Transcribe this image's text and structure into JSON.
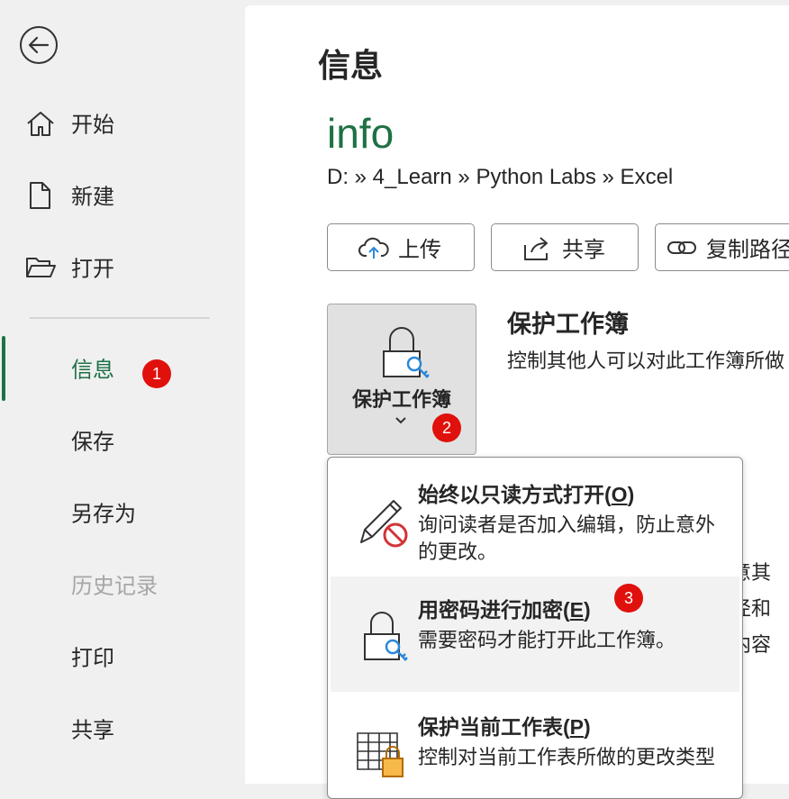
{
  "sidebar": {
    "back_icon": "arrow-left-circle-icon",
    "items": [
      {
        "label": "开始",
        "icon": "home-icon"
      },
      {
        "label": "新建",
        "icon": "new-document-icon"
      },
      {
        "label": "打开",
        "icon": "folder-open-icon"
      },
      {
        "label": "信息",
        "active": true
      },
      {
        "label": "保存"
      },
      {
        "label": "另存为"
      },
      {
        "label": "历史记录",
        "disabled": true
      },
      {
        "label": "打印"
      },
      {
        "label": "共享"
      }
    ]
  },
  "badges": [
    "1",
    "2",
    "3"
  ],
  "main": {
    "title": "信息",
    "file_name": "info",
    "file_path": "D: » 4_Learn » Python Labs » Excel",
    "buttons": {
      "upload": "上传",
      "share": "共享",
      "copy_path": "复制路径"
    },
    "protect": {
      "tile_label": "保护工作簿",
      "title": "保护工作簿",
      "description": "控制其他人可以对此工作簿所做",
      "bg_fragments": [
        "意其",
        "径和",
        "内容"
      ]
    }
  },
  "dropdown": {
    "items": [
      {
        "title": "始终以只读方式打开(",
        "key": "O",
        "suffix": ")",
        "desc": "询问读者是否加入编辑，防止意外的更改。",
        "icon": "pencil-no-icon"
      },
      {
        "title": "用密码进行加密(",
        "key": "E",
        "suffix": ")",
        "desc": "需要密码才能打开此工作簿。",
        "icon": "lock-key-icon"
      },
      {
        "title": "保护当前工作表(",
        "key": "P",
        "suffix": ")",
        "desc": "控制对当前工作表所做的更改类型",
        "icon": "sheet-lock-icon"
      }
    ]
  },
  "colors": {
    "accent": "#1e7145",
    "badge": "#e0100c"
  }
}
